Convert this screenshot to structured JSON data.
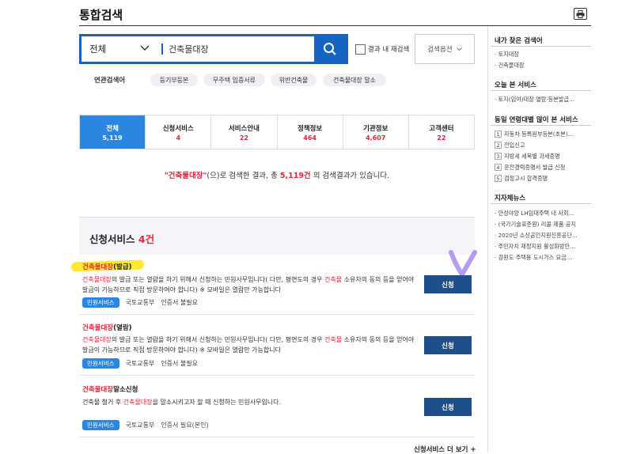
{
  "header": {
    "title": "통합검색"
  },
  "search": {
    "scope": "전체",
    "query": "건축물대장",
    "research_label": "결과 내 재검색",
    "options_label": "검색옵션"
  },
  "related": {
    "label": "연관검색어",
    "tags": [
      "등기부등본",
      "무주택 입증서류",
      "위반건축물",
      "건축물대장 말소"
    ]
  },
  "tabs": [
    {
      "name": "전체",
      "count": "5,119"
    },
    {
      "name": "신청서비스",
      "count": "4"
    },
    {
      "name": "서비스안내",
      "count": "22"
    },
    {
      "name": "정책정보",
      "count": "464"
    },
    {
      "name": "기관정보",
      "count": "4,607"
    },
    {
      "name": "고객센터",
      "count": "22"
    }
  ],
  "summary": {
    "query_quoted": "\"건축물대장\"",
    "middle": "(으)로 검색한 결과, 총",
    "total": "5,119건",
    "end": "의 검색결과가 있습니다."
  },
  "section": {
    "title": "신청서비스",
    "count": "4건"
  },
  "items": [
    {
      "title_red": "건축물대장",
      "title_rest": "(발급)",
      "desc_line1_red": "건축물대장",
      "desc_line1_a": "의 발급 또는 열람을 하기 위해서 신청하는 민원사무입니다( 다만, 평면도의 경우",
      "desc_line1_red2": "건축물",
      "desc_line1_b": "소유자의 동의 등",
      "desc_line2": "을 얻어야 발급이 가능하므로 직접 방문하여야 합니다) ※ 모바일은 열람만 가능합니다",
      "badge": "민원서비스",
      "agency": "국토교통부",
      "cert": "인증서 불필요",
      "button": "신청"
    },
    {
      "title_red": "건축물대장",
      "title_rest": "(열람)",
      "desc_line1_red": "건축물대장",
      "desc_line1_a": "의 발급 또는 열람을 하기 위해서 신청하는 민원사무입니다( 다만, 평면도의 경우",
      "desc_line1_red2": "건축물",
      "desc_line1_b": "소유자의 동의 등",
      "desc_line2": "을 얻어야 발급이 가능하므로 직접 방문하여야 합니다) ※ 모바일은 열람만 가능합니다",
      "badge": "민원서비스",
      "agency": "국토교통부",
      "cert": "인증서 불필요",
      "button": "신청"
    },
    {
      "title_red": "건축물대장",
      "title_rest": "말소신청",
      "desc_a": "건축물 철거 후",
      "desc_red": "건축물대장",
      "desc_b": "을 말소시키고자 할 때 신청하는 민원사무입니다.",
      "badge": "민원서비스",
      "agency": "국토교통부",
      "cert": "인증서 필요(본인)",
      "button": "신청"
    }
  ],
  "more_link": "신청서비스 더 보기 +",
  "sidebar": {
    "my_searches": {
      "title": "내가 찾은 검색어",
      "items": [
        "· 토지대장",
        "· 건축물대장"
      ]
    },
    "today_viewed": {
      "title": "오늘 본 서비스",
      "items": [
        "· 토지(임야)대장 열람·등본발급..."
      ]
    },
    "popular": {
      "title": "동일 연령대별 많이 본 서비스",
      "items": [
        "자동차 등록원부등본(초본)...",
        "전입신고",
        "지방세 세목별 과세증명",
        "운전경력증명서 발급 신청",
        "검정고시 합격증명"
      ]
    },
    "news": {
      "title": "지자체뉴스",
      "items": [
        "· 안성야양 LH임대주택 내 사회...",
        "· (국가기술표준원) 리콜 제품 공지",
        "· 2020년 소상공인지원진흥공단...",
        "· 주민자치 재정지원 활성화방안...",
        "· 강원도 주택용 도시가스 요금..."
      ]
    }
  },
  "colors": {
    "primary": "#1565c0",
    "accent_red": "#e8263d",
    "tab_active": "#2b86e0",
    "button": "#1f4e8c"
  }
}
